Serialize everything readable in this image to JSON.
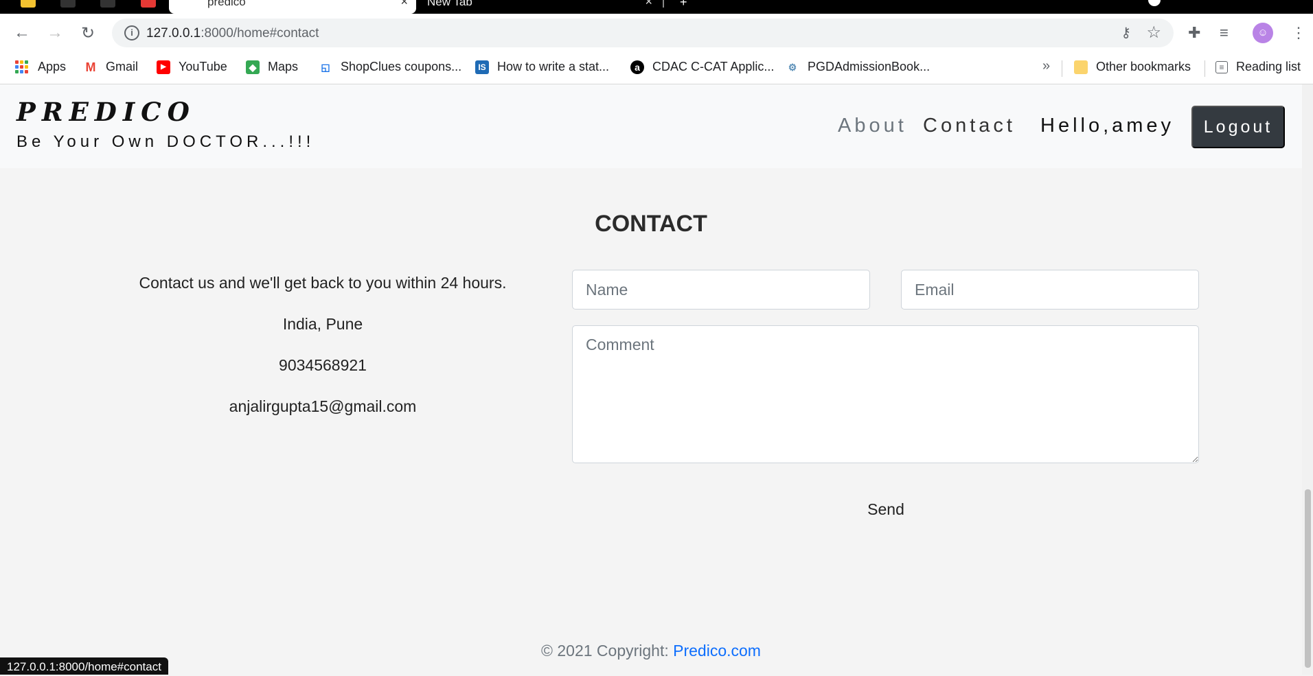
{
  "browser": {
    "tabs": [
      {
        "title": "predico"
      },
      {
        "title": "New Tab"
      }
    ],
    "url": {
      "host": "127.0.0.1",
      "rest": ":8000/home#contact"
    },
    "bookmarks": [
      {
        "label": "Apps",
        "icon": "apps-grid-icon"
      },
      {
        "label": "Gmail",
        "icon": "gmail-icon",
        "color": "#EA4335"
      },
      {
        "label": "YouTube",
        "icon": "youtube-icon",
        "color": "#FF0000"
      },
      {
        "label": "Maps",
        "icon": "maps-icon",
        "color": "#34A853"
      },
      {
        "label": "ShopClues coupons...",
        "icon": "shopclues-icon",
        "color": "#1a73e8"
      },
      {
        "label": "How to write a stat...",
        "icon": "site-is-icon",
        "color": "#1f6bb5"
      },
      {
        "label": "CDAC C-CAT Applic...",
        "icon": "cdac-icon",
        "color": "#000000"
      },
      {
        "label": "PGDAdmissionBook...",
        "icon": "pgd-icon",
        "color": "#5a8fb8"
      }
    ],
    "overflow": "»",
    "other_bookmarks": "Other bookmarks",
    "reading_list": "Reading list",
    "status_url": "127.0.0.1:8000/home#contact"
  },
  "site": {
    "brand": "PREDICO",
    "tagline": "Be Your Own DOCTOR...!!!",
    "nav": {
      "about": "About",
      "contact": "Contact",
      "greeting": "Hello,amey",
      "logout": "Logout"
    }
  },
  "contact": {
    "title": "CONTACT",
    "intro": "Contact us and we'll get back to you within 24 hours.",
    "location": "India, Pune",
    "phone": "9034568921",
    "email": "anjalirgupta15@gmail.com",
    "form": {
      "name_placeholder": "Name",
      "email_placeholder": "Email",
      "comment_placeholder": "Comment",
      "send_label": "Send"
    }
  },
  "footer": {
    "copyright": "© 2021 Copyright: ",
    "link": "Predico.com"
  },
  "colors": {
    "navbar_bg": "#f8f9fa",
    "page_bg": "#f4f4f4",
    "logout_bg": "#343a40",
    "link": "#0d6efd"
  }
}
